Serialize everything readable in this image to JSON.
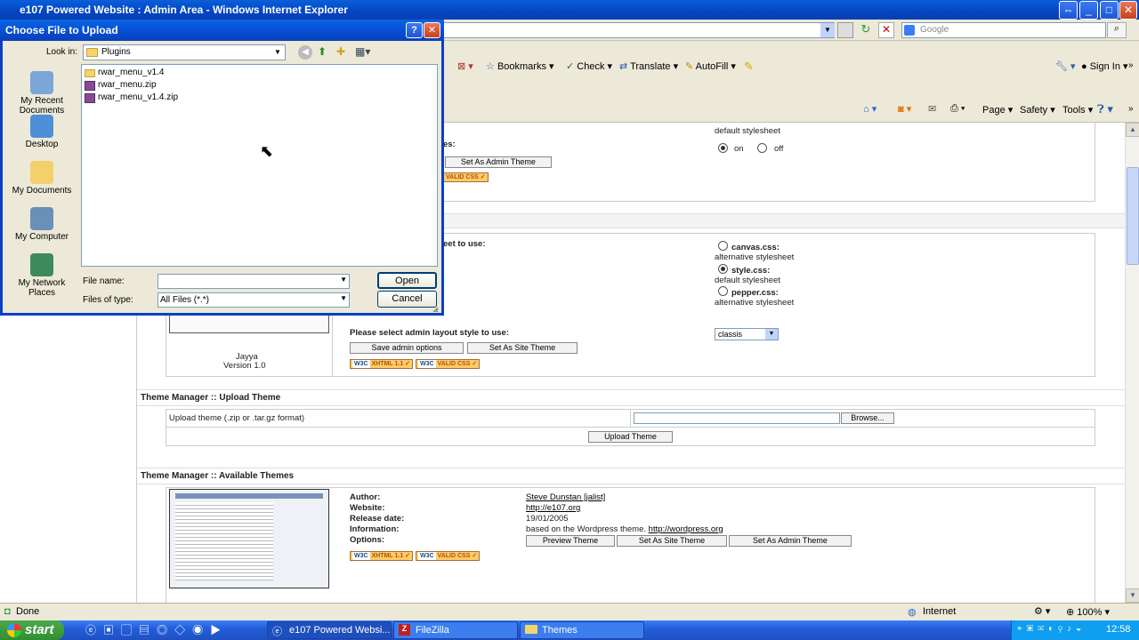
{
  "ie": {
    "title": "e107 Powered Website : Admin Area - Windows Internet Explorer",
    "search_placeholder": "Google",
    "toolbar": {
      "bookmarks": "Bookmarks",
      "check": "Check",
      "translate": "Translate",
      "autofill": "AutoFill",
      "sign_in": "Sign In"
    },
    "command_bar": {
      "page": "Page",
      "safety": "Safety",
      "tools": "Tools"
    },
    "status": {
      "text": "Done",
      "zone": "Internet",
      "zoom": "100%"
    }
  },
  "dialog": {
    "title": "Choose File to Upload",
    "look_in_label": "Look in:",
    "look_in_value": "Plugins",
    "places": [
      "My Recent Documents",
      "Desktop",
      "My Documents",
      "My Computer",
      "My Network Places"
    ],
    "files": [
      {
        "name": "rwar_menu_v1.4",
        "type": "folder"
      },
      {
        "name": "rwar_menu.zip",
        "type": "zip"
      },
      {
        "name": "rwar_menu_v1.4.zip",
        "type": "zip"
      }
    ],
    "file_name_label": "File name:",
    "file_name_value": "",
    "files_of_type_label": "Files of type:",
    "files_of_type_value": "All Files (*.*)",
    "open_label": "Open",
    "cancel_label": "Cancel"
  },
  "page": {
    "top_partial": {
      "default_stylesheet": "default stylesheet",
      "on": "on",
      "off": "off",
      "set_admin_theme": "Set As Admin Theme",
      "partial_label_es": "es:",
      "valid_css": "VALID CSS"
    },
    "stylesheet_section": {
      "partial_label": "eet to use:",
      "options": [
        {
          "name": "canvas.css:",
          "desc": "alternative stylesheet",
          "selected": false
        },
        {
          "name": "style.css:",
          "desc": "default stylesheet",
          "selected": true
        },
        {
          "name": "pepper.css:",
          "desc": "alternative stylesheet",
          "selected": false
        }
      ],
      "theme_name": "Jayya",
      "theme_version": "Version 1.0",
      "layout_label": "Please select admin layout style to use:",
      "layout_value": "classis",
      "save_admin_options": "Save admin options",
      "set_site_theme": "Set As Site Theme",
      "xhtml_badge": "XHTML 1.1",
      "css_badge": "VALID CSS",
      "w3c": "W3C"
    },
    "upload": {
      "title": "Theme Manager :: Upload Theme",
      "label": "Upload theme (.zip or .tar.gz format)",
      "browse": "Browse...",
      "upload_button": "Upload Theme"
    },
    "available": {
      "title": "Theme Manager :: Available Themes",
      "author_label": "Author:",
      "author_value": "Steve Dunstan [jalist]",
      "website_label": "Website:",
      "website_value": "http://e107.org",
      "release_label": "Release date:",
      "release_value": "19/01/2005",
      "info_label": "Information:",
      "info_value_prefix": "based on the Wordpress theme.",
      "info_link": "http://wordpress.org",
      "options_label": "Options:",
      "preview": "Preview Theme",
      "set_site": "Set As Site Theme",
      "set_admin": "Set As Admin Theme"
    }
  },
  "taskbar": {
    "start": "start",
    "tasks": [
      "e107 Powered Websi...",
      "FileZilla",
      "Themes"
    ],
    "clock": "12:58"
  }
}
